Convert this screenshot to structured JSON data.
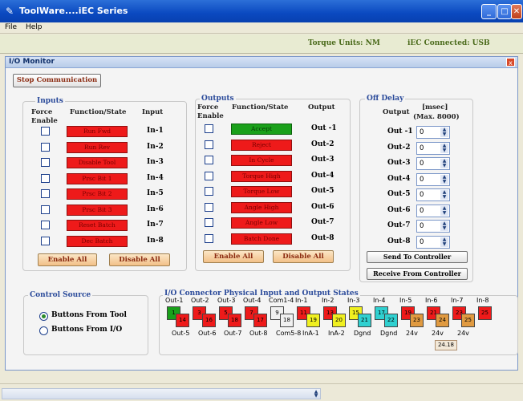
{
  "window": {
    "title": "ToolWare....iEC Series",
    "min": "_",
    "max": "□",
    "close": "✕"
  },
  "menu": {
    "file": "File",
    "help": "Help"
  },
  "info": {
    "torque_units": "Torque Units: NM",
    "connection": "iEC Connected: USB"
  },
  "panel": {
    "title": "I/O Monitor",
    "close": "x"
  },
  "stop_button": "Stop Communication",
  "inputs": {
    "group": "Inputs",
    "h_force": "Force Enable",
    "h_function": "Function/State",
    "h_input": "Input",
    "rows": [
      {
        "func": "Run Fwd",
        "io": "In-1"
      },
      {
        "func": "Run Rev",
        "io": "In-2"
      },
      {
        "func": "Disable Tool",
        "io": "In-3"
      },
      {
        "func": "Prsc Bit 1",
        "io": "In-4"
      },
      {
        "func": "Prsc Bit 2",
        "io": "In-5"
      },
      {
        "func": "Prsc Bit 3",
        "io": "In-6"
      },
      {
        "func": "Reset Batch",
        "io": "In-7"
      },
      {
        "func": "Dec Batch",
        "io": "In-8"
      }
    ],
    "enable_all": "Enable All",
    "disable_all": "Disable All"
  },
  "outputs": {
    "group": "Outputs",
    "h_force": "Force Enable",
    "h_function": "Function/State",
    "h_output": "Output",
    "rows": [
      {
        "func": "Accept",
        "io": "Out -1",
        "state": "on"
      },
      {
        "func": "Reject",
        "io": "Out-2",
        "state": "off"
      },
      {
        "func": "In Cycle",
        "io": "Out-3",
        "state": "off"
      },
      {
        "func": "Torque High",
        "io": "Out-4",
        "state": "off"
      },
      {
        "func": "Torque Low",
        "io": "Out-5",
        "state": "off"
      },
      {
        "func": "Angle High",
        "io": "Out-6",
        "state": "off"
      },
      {
        "func": "Angle Low",
        "io": "Out-7",
        "state": "off"
      },
      {
        "func": "Batch Done",
        "io": "Out-8",
        "state": "off"
      }
    ],
    "enable_all": "Enable All",
    "disable_all": "Disable All"
  },
  "off_delay": {
    "group": "Off Delay",
    "h_output": "Output",
    "h_msec": "[msec]",
    "h_max": "(Max. 8000)",
    "rows": [
      {
        "io": "Out -1",
        "value": "0"
      },
      {
        "io": "Out-2",
        "value": "0"
      },
      {
        "io": "Out-3",
        "value": "0"
      },
      {
        "io": "Out-4",
        "value": "0"
      },
      {
        "io": "Out-5",
        "value": "0"
      },
      {
        "io": "Out-6",
        "value": "0"
      },
      {
        "io": "Out-7",
        "value": "0"
      },
      {
        "io": "Out-8",
        "value": "0"
      }
    ],
    "send": "Send To Controller",
    "receive": "Receive From Controller"
  },
  "control_source": {
    "group": "Control Source",
    "opt1": "Buttons From Tool",
    "opt2": "Buttons From I/O",
    "selected": "Buttons From Tool"
  },
  "connector": {
    "group": "I/O Connector Physical Input and Output States",
    "top_labels": [
      "Out-1",
      "Out-2",
      "Out-3",
      "Out-4",
      "Com1-4",
      "In-1",
      "In-2",
      "In-3",
      "In-4",
      "In-5",
      "In-6",
      "In-7",
      "In-8"
    ],
    "top_pins": [
      {
        "n": "1",
        "color": "#1aa01a"
      },
      {
        "n": "3",
        "color": "#ee1a1a"
      },
      {
        "n": "5",
        "color": "#ee1a1a"
      },
      {
        "n": "7",
        "color": "#ee1a1a"
      },
      {
        "n": "9",
        "color": "#f0f0f0"
      },
      {
        "n": "11",
        "color": "#ee1a1a"
      },
      {
        "n": "13",
        "color": "#ee1a1a"
      },
      {
        "n": "15",
        "color": "#f0f020"
      },
      {
        "n": "17",
        "color": "#30d0d0"
      },
      {
        "n": "19",
        "color": "#ee1a1a"
      },
      {
        "n": "21",
        "color": "#ee1a1a"
      },
      {
        "n": "23",
        "color": "#ee1a1a"
      },
      {
        "n": "25",
        "color": "#ee1a1a"
      }
    ],
    "bottom_pins": [
      {
        "n": "14",
        "color": "#ee1a1a"
      },
      {
        "n": "16",
        "color": "#ee1a1a"
      },
      {
        "n": "18",
        "color": "#ee1a1a"
      },
      {
        "n": "17",
        "color": "#ee1a1a"
      },
      {
        "n": "18",
        "color": "#f0f0f0"
      },
      {
        "n": "19",
        "color": "#f0f020"
      },
      {
        "n": "20",
        "color": "#f0f020"
      },
      {
        "n": "21",
        "color": "#30d0d0"
      },
      {
        "n": "22",
        "color": "#30d0d0"
      },
      {
        "n": "23",
        "color": "#e09a40"
      },
      {
        "n": "24",
        "color": "#e09a40"
      },
      {
        "n": "25",
        "color": "#e09a40"
      }
    ],
    "bottom_labels": [
      "Out-5",
      "Out-6",
      "Out-7",
      "Out-8",
      "Com5-8",
      "InA-1",
      "InA-2",
      "Dgnd",
      "Dgnd",
      "24v",
      "24v",
      "24v"
    ],
    "voltage": "24.18"
  },
  "colors": {
    "on": "#1aa01a",
    "off": "#ee1a1a"
  }
}
